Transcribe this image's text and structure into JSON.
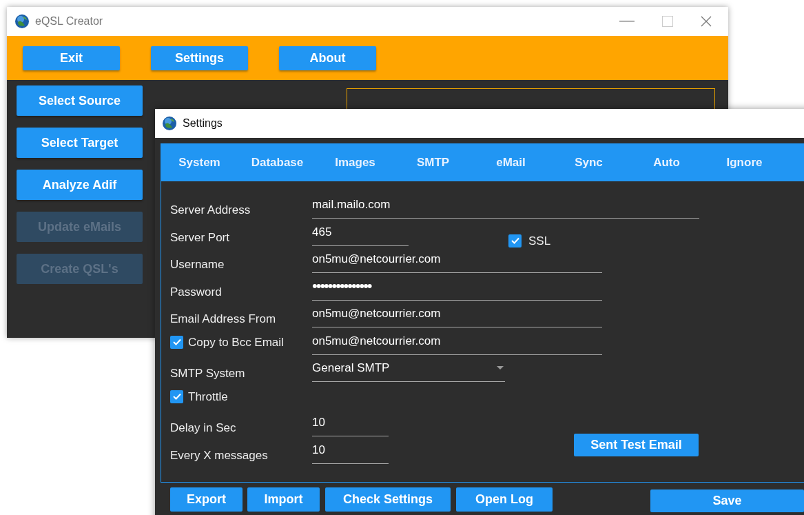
{
  "main_window": {
    "title": "eQSL Creator",
    "toolbar": [
      {
        "label": "Exit"
      },
      {
        "label": "Settings"
      },
      {
        "label": "About"
      }
    ],
    "sidebar": [
      {
        "label": "Select Source",
        "disabled": false
      },
      {
        "label": "Select Target",
        "disabled": false
      },
      {
        "label": "Analyze Adif",
        "disabled": false
      },
      {
        "label": "Update eMails",
        "disabled": true
      },
      {
        "label": "Create QSL's",
        "disabled": true
      }
    ]
  },
  "settings_window": {
    "title": "Settings",
    "tabs": [
      {
        "label": "System"
      },
      {
        "label": "Database"
      },
      {
        "label": "Images"
      },
      {
        "label": "SMTP"
      },
      {
        "label": "eMail"
      },
      {
        "label": "Sync"
      },
      {
        "label": "Auto"
      },
      {
        "label": "Ignore"
      }
    ],
    "rows": [
      {
        "label": "Server Address",
        "field": {
          "kind": "text",
          "value": "mail.mailo.com"
        }
      },
      {
        "label": "Server Port",
        "field": {
          "kind": "text",
          "value": "465"
        },
        "side_checkbox": {
          "label": "SSL",
          "checked": true
        }
      },
      {
        "label": "Username",
        "field": {
          "kind": "text",
          "value": "on5mu@netcourrier.com"
        }
      },
      {
        "label": "Password",
        "field": {
          "kind": "password",
          "value": "•••••••••••••••"
        }
      },
      {
        "label": "Email Address From",
        "field": {
          "kind": "text",
          "value": "on5mu@netcourrier.com"
        }
      },
      {
        "checkbox": {
          "label": "Copy to Bcc Email",
          "checked": true
        },
        "field": {
          "kind": "text",
          "value": "on5mu@netcourrier.com"
        }
      },
      {
        "label": "SMTP System",
        "field": {
          "kind": "select",
          "value": "General SMTP"
        }
      },
      {
        "checkbox": {
          "label": "Throttle",
          "checked": true
        }
      },
      {
        "label": "Delay in Sec",
        "field": {
          "kind": "text",
          "value": "10"
        }
      },
      {
        "label": "Every X messages",
        "field": {
          "kind": "text",
          "value": "10"
        },
        "action": "Sent Test Email"
      }
    ],
    "footer_buttons": [
      "Export",
      "Import",
      "Check Settings",
      "Open Log"
    ],
    "save_button": "Save"
  }
}
